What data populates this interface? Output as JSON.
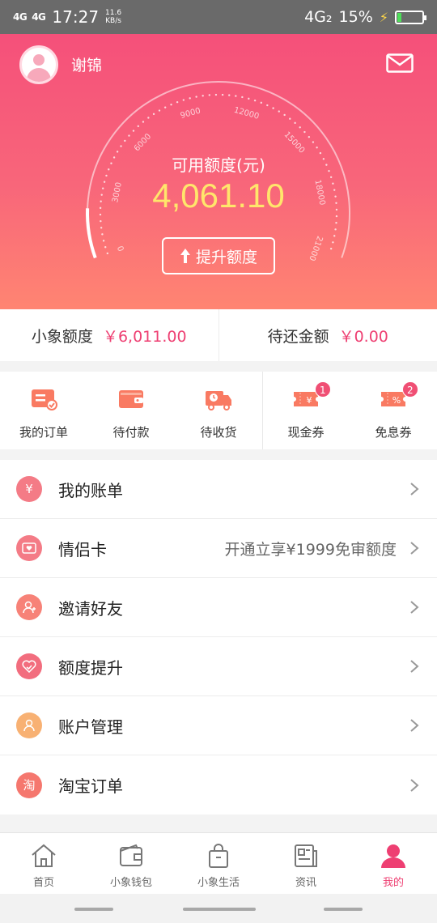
{
  "status_bar": {
    "signal1": "4G",
    "signal2": "4G",
    "time": "17:27",
    "speed_value": "11.6",
    "speed_unit": "KB/s",
    "network": "4G₂",
    "battery": "15%"
  },
  "header": {
    "username": "谢锦",
    "credit_label": "可用额度(元)",
    "credit_amount": "4,061.10",
    "raise_button": "提升额度",
    "gauge_ticks": [
      "0",
      "3000",
      "6000",
      "9000",
      "12000",
      "15000",
      "18000",
      "21000"
    ]
  },
  "summary": {
    "limit_label": "小象额度",
    "limit_value": "￥6,011.00",
    "due_label": "待还金额",
    "due_value": "￥0.00"
  },
  "shortcuts": [
    {
      "label": "我的订单",
      "icon": "order-icon"
    },
    {
      "label": "待付款",
      "icon": "wallet-icon"
    },
    {
      "label": "待收货",
      "icon": "truck-icon"
    },
    {
      "label": "现金券",
      "icon": "cash-coupon-icon",
      "badge": "1"
    },
    {
      "label": "免息券",
      "icon": "interest-free-coupon-icon",
      "badge": "2"
    }
  ],
  "menu": [
    {
      "label": "我的账单",
      "icon": "bill-icon",
      "glyph": "¥",
      "color": "#f47b86"
    },
    {
      "label": "情侣卡",
      "icon": "couple-card-icon",
      "sub": "开通立享¥1999免审额度",
      "color": "#f47b86"
    },
    {
      "label": "邀请好友",
      "icon": "invite-friend-icon",
      "color": "#f78278"
    },
    {
      "label": "额度提升",
      "icon": "heart-icon",
      "color": "#f26d7e"
    },
    {
      "label": "账户管理",
      "icon": "account-icon",
      "color": "#f8b173"
    },
    {
      "label": "淘宝订单",
      "icon": "taobao-icon",
      "glyph": "淘",
      "color": "#f5776e"
    }
  ],
  "tabbar": [
    {
      "label": "首页",
      "icon": "home-icon"
    },
    {
      "label": "小象钱包",
      "icon": "wallet-tab-icon"
    },
    {
      "label": "小象生活",
      "icon": "bag-icon"
    },
    {
      "label": "资讯",
      "icon": "news-icon"
    },
    {
      "label": "我的",
      "icon": "profile-icon",
      "active": true
    }
  ],
  "colors": {
    "accent": "#ee3f72",
    "amount": "#ffe66b",
    "hero_top": "#f5507a",
    "hero_bottom": "#ff8572"
  }
}
